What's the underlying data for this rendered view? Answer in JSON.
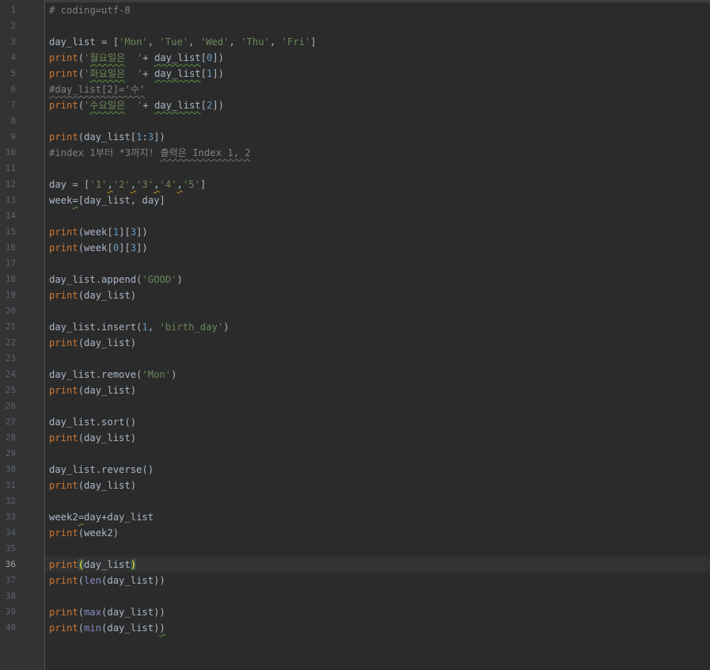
{
  "editor": {
    "language": "python",
    "current_line": 36,
    "colors": {
      "background": "#2b2b2b",
      "gutter": "#313335",
      "keyword": "#cc7832",
      "string": "#6a8759",
      "number": "#6897bb",
      "comment": "#808080",
      "builtin": "#8888c6",
      "text": "#a9b7c6"
    },
    "line_numbers": [
      "1",
      "2",
      "3",
      "4",
      "5",
      "6",
      "7",
      "8",
      "9",
      "10",
      "11",
      "12",
      "13",
      "14",
      "15",
      "16",
      "17",
      "18",
      "19",
      "20",
      "21",
      "22",
      "23",
      "24",
      "25",
      "26",
      "27",
      "28",
      "29",
      "30",
      "31",
      "32",
      "33",
      "34",
      "35",
      "36",
      "37",
      "38",
      "39",
      "40"
    ],
    "lines": [
      [
        [
          "cmt",
          "# coding=utf-8"
        ]
      ],
      [],
      [
        [
          "t",
          "day_list = ["
        ],
        [
          "str",
          "'Mon'"
        ],
        [
          "t",
          ", "
        ],
        [
          "str",
          "'Tue'"
        ],
        [
          "t",
          ", "
        ],
        [
          "str",
          "'Wed'"
        ],
        [
          "t",
          ", "
        ],
        [
          "str",
          "'Thu'"
        ],
        [
          "t",
          ", "
        ],
        [
          "str",
          "'Fri'"
        ],
        [
          "t",
          "]"
        ]
      ],
      [
        [
          "kw",
          "print"
        ],
        [
          "t",
          "("
        ],
        [
          "str",
          "'"
        ],
        [
          "str-wavy",
          "월요일은"
        ],
        [
          "str",
          "  '"
        ],
        [
          "t",
          "+ "
        ],
        [
          "wavy",
          "day_list"
        ],
        [
          "t",
          "["
        ],
        [
          "num",
          "0"
        ],
        [
          "t",
          "])"
        ]
      ],
      [
        [
          "kw",
          "print"
        ],
        [
          "t",
          "("
        ],
        [
          "str",
          "'"
        ],
        [
          "str-wavy",
          "화요일은"
        ],
        [
          "str",
          "  '"
        ],
        [
          "t",
          "+ "
        ],
        [
          "wavy",
          "day_list"
        ],
        [
          "t",
          "["
        ],
        [
          "num",
          "1"
        ],
        [
          "t",
          "])"
        ]
      ],
      [
        [
          "cmt-wavy",
          "#day_list[2]='수'"
        ]
      ],
      [
        [
          "kw",
          "print"
        ],
        [
          "t",
          "("
        ],
        [
          "str",
          "'"
        ],
        [
          "str-wavy",
          "수요일은"
        ],
        [
          "str",
          "  '"
        ],
        [
          "t",
          "+ "
        ],
        [
          "wavy",
          "day_list"
        ],
        [
          "t",
          "["
        ],
        [
          "num",
          "2"
        ],
        [
          "t",
          "])"
        ]
      ],
      [],
      [
        [
          "kw",
          "print"
        ],
        [
          "t",
          "(day_list["
        ],
        [
          "num",
          "1"
        ],
        [
          "t",
          ":"
        ],
        [
          "num",
          "3"
        ],
        [
          "t",
          "])"
        ]
      ],
      [
        [
          "cmt",
          "#index 1부터 *3까지! "
        ],
        [
          "cmt-wavy",
          "출력은 Index 1, 2"
        ]
      ],
      [],
      [
        [
          "t",
          "day = ["
        ],
        [
          "str",
          "'1'"
        ],
        [
          "warn",
          ","
        ],
        [
          "str",
          "'2'"
        ],
        [
          "warn",
          ","
        ],
        [
          "str",
          "'3'"
        ],
        [
          "warn",
          ","
        ],
        [
          "str",
          "'4'"
        ],
        [
          "warn",
          ","
        ],
        [
          "str",
          "'5'"
        ],
        [
          "t",
          "]"
        ]
      ],
      [
        [
          "t",
          "week"
        ],
        [
          "wavy",
          "="
        ],
        [
          "t",
          "[day_list, day]"
        ]
      ],
      [],
      [
        [
          "kw",
          "print"
        ],
        [
          "t",
          "(week["
        ],
        [
          "num",
          "1"
        ],
        [
          "t",
          "]["
        ],
        [
          "num",
          "3"
        ],
        [
          "t",
          "])"
        ]
      ],
      [
        [
          "kw",
          "print"
        ],
        [
          "t",
          "(week["
        ],
        [
          "num",
          "0"
        ],
        [
          "t",
          "]["
        ],
        [
          "num",
          "3"
        ],
        [
          "t",
          "])"
        ]
      ],
      [],
      [
        [
          "t",
          "day_list.append("
        ],
        [
          "str",
          "'GOOD'"
        ],
        [
          "t",
          ")"
        ]
      ],
      [
        [
          "kw",
          "print"
        ],
        [
          "t",
          "(day_list)"
        ]
      ],
      [],
      [
        [
          "t",
          "day_list.insert("
        ],
        [
          "num",
          "1"
        ],
        [
          "t",
          ", "
        ],
        [
          "str",
          "'birth_day'"
        ],
        [
          "t",
          ")"
        ]
      ],
      [
        [
          "kw",
          "print"
        ],
        [
          "t",
          "(day_list)"
        ]
      ],
      [],
      [
        [
          "t",
          "day_list.remove("
        ],
        [
          "str",
          "'Mon'"
        ],
        [
          "t",
          ")"
        ]
      ],
      [
        [
          "kw",
          "print"
        ],
        [
          "t",
          "(day_list)"
        ]
      ],
      [],
      [
        [
          "t",
          "day_list.sort()"
        ]
      ],
      [
        [
          "kw",
          "print"
        ],
        [
          "t",
          "(day_list)"
        ]
      ],
      [],
      [
        [
          "t",
          "day_list.reverse()"
        ]
      ],
      [
        [
          "kw",
          "print"
        ],
        [
          "t",
          "(day_list)"
        ]
      ],
      [],
      [
        [
          "t",
          "week2"
        ],
        [
          "wavy",
          "="
        ],
        [
          "t",
          "day+day_list"
        ]
      ],
      [
        [
          "kw",
          "print"
        ],
        [
          "t",
          "(week2)"
        ]
      ],
      [],
      [
        [
          "kw",
          "print"
        ],
        [
          "brace",
          "("
        ],
        [
          "t",
          "day_list"
        ],
        [
          "brace",
          ")"
        ]
      ],
      [
        [
          "kw",
          "print"
        ],
        [
          "t",
          "("
        ],
        [
          "bi",
          "len"
        ],
        [
          "t",
          "(day_list))"
        ]
      ],
      [],
      [
        [
          "kw",
          "print"
        ],
        [
          "t",
          "("
        ],
        [
          "bi",
          "max"
        ],
        [
          "t",
          "(day_list))"
        ]
      ],
      [
        [
          "kw",
          "print"
        ],
        [
          "t",
          "("
        ],
        [
          "bi",
          "min"
        ],
        [
          "t",
          "(day_list)"
        ],
        [
          "wavy",
          ")"
        ]
      ]
    ]
  }
}
